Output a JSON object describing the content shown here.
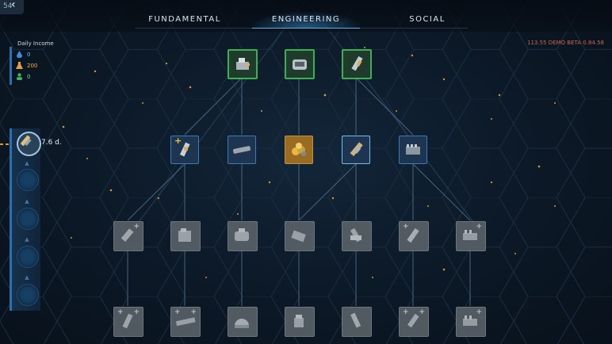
{
  "header": {
    "back_number": "54",
    "tabs": [
      {
        "label": "FUNDAMENTAL",
        "active": false
      },
      {
        "label": "ENGINEERING",
        "active": true
      },
      {
        "label": "SOCIAL",
        "active": false
      }
    ],
    "version": "113.55 DEMO BETA 0.84.58"
  },
  "income": {
    "title": "Daily Income",
    "items": [
      {
        "icon": "water-icon",
        "value": "0",
        "color": "#3f8bd8"
      },
      {
        "icon": "research-flask-icon",
        "value": "200",
        "color": "#e8a13a"
      },
      {
        "icon": "colonist-icon",
        "value": "0",
        "color": "#44b35a"
      }
    ]
  },
  "timeline": {
    "remaining": "7.6 d.",
    "accent_color": "#e0962c"
  },
  "tech_tree": {
    "tier1": [
      "mining-machine-icon",
      "compressor-machine-icon",
      "drill-tool-icon"
    ],
    "tier2": [
      "extractor-upgrade-icon",
      "conveyor-belt-icon",
      "ore-pile-icon",
      "mech-arm-icon",
      "battery-pack-icon"
    ],
    "tier3": [
      "locked-drill-icon",
      "locked-machine-icon",
      "locked-tank-icon",
      "locked-pump-icon",
      "locked-arm-icon",
      "locked-tool-icon",
      "locked-battery-icon"
    ],
    "tier4": [
      "locked-drill-icon",
      "locked-belt-icon",
      "locked-dome-icon",
      "locked-robot-icon",
      "locked-rocket-icon",
      "locked-arm-icon",
      "locked-battery-icon"
    ],
    "colors": {
      "researched": "#3fae57",
      "available": "#3c7bb4",
      "selected": "#c88f2d",
      "locked": "#7d858c"
    }
  }
}
